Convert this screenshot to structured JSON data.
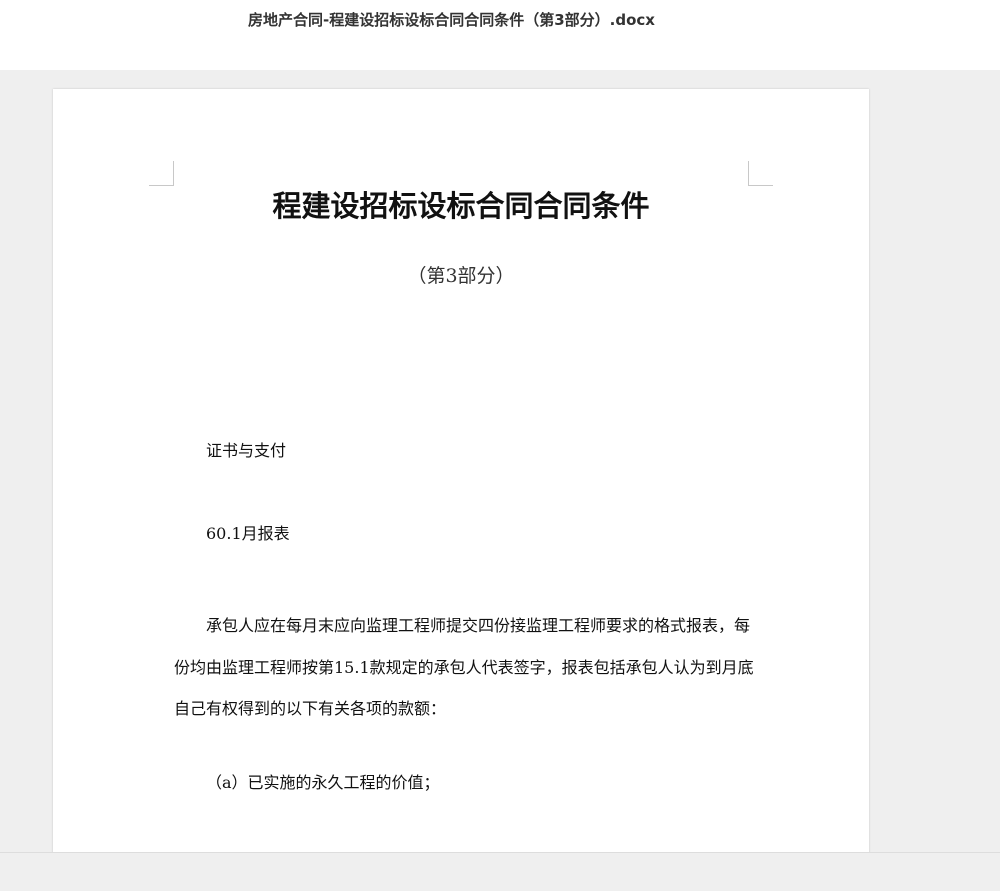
{
  "window": {
    "file_title": "房地产合同-程建设招标设标合同合同条件（第3部分）.docx"
  },
  "document": {
    "title": "程建设招标设标合同合同条件",
    "subtitle": "（第3部分）",
    "paragraphs": [
      "证书与支付",
      "60.1月报表",
      "承包人应在每月末应向监理工程师提交四份接监理工程师要求的格式报表，每份均由监理工程师按第15.1款规定的承包人代表签字，报表包括承包人认为到月底自己有权得到的以下有关各项的款额：",
      "（a）已实施的永久工程的价值；"
    ]
  }
}
